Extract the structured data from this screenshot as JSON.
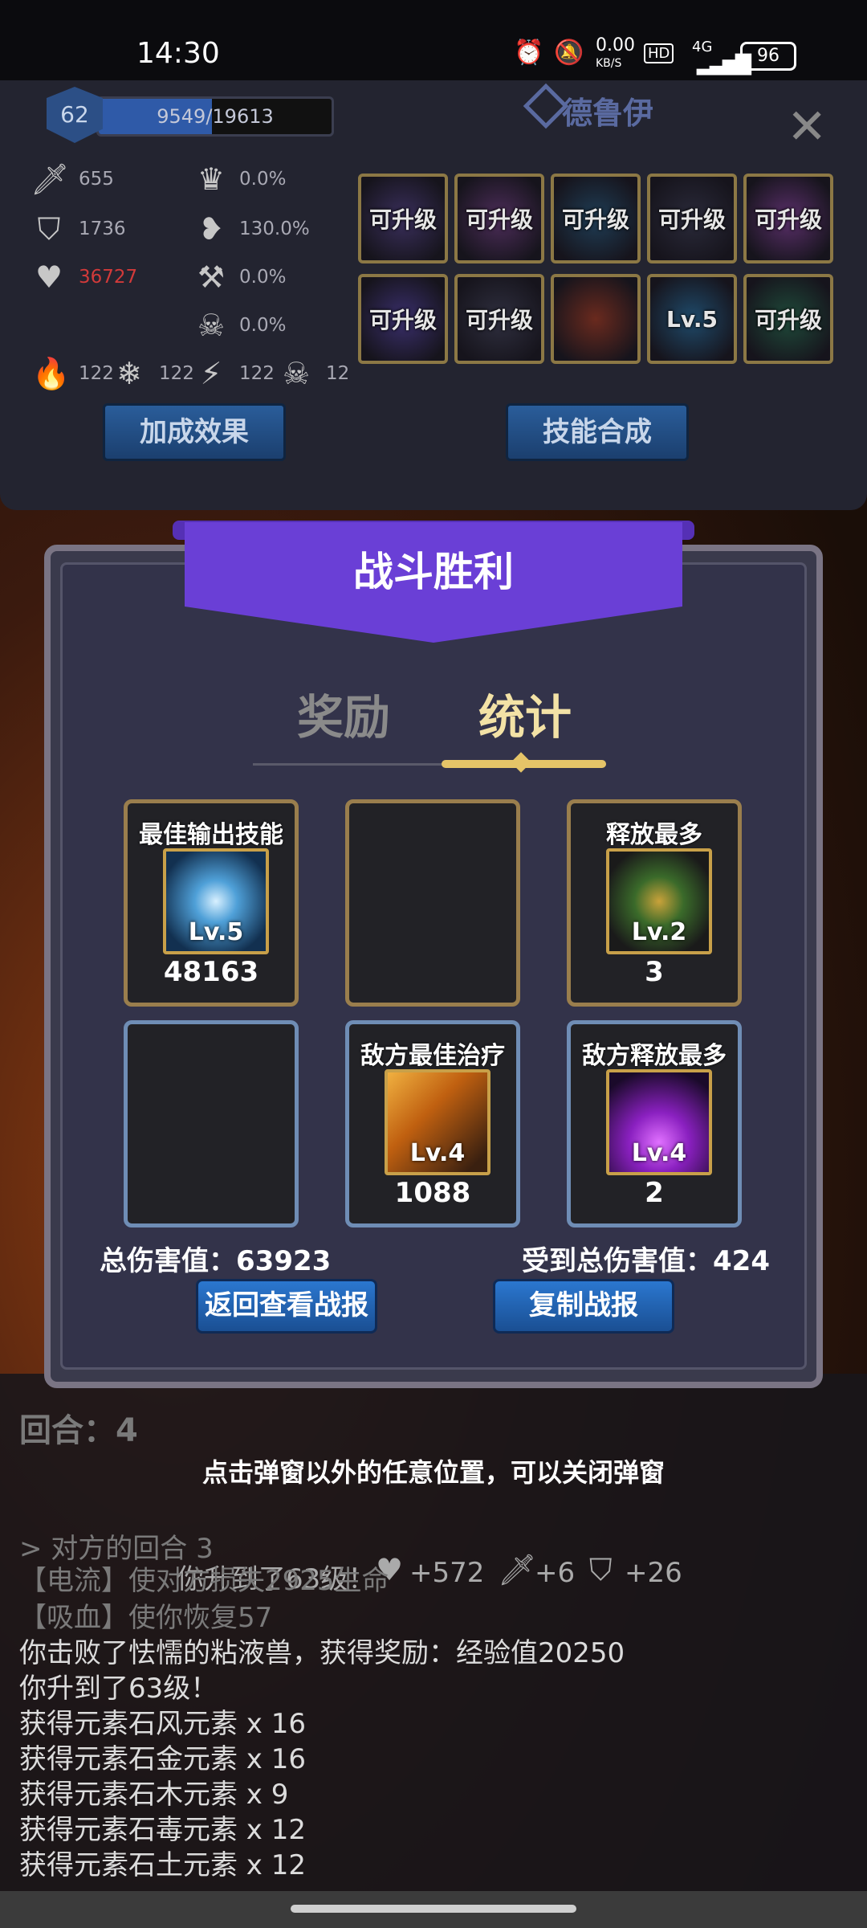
{
  "status": {
    "time": "14:30",
    "net_speed": "0.00",
    "net_unit": "KB/S",
    "hd": "HD",
    "signal": "4G",
    "battery": "96"
  },
  "character": {
    "level": "62",
    "xp": "9549/19613",
    "xp_fraction": 0.487,
    "name": "德鲁伊"
  },
  "stats": {
    "attack": "655",
    "defense": "1736",
    "hp": "36727",
    "crit": "0.0%",
    "crit_dmg": "130.0%",
    "pierce": "0.0%",
    "poison": "0.0%",
    "fire": "122",
    "ice": "122",
    "lightning": "122",
    "skull": "12"
  },
  "skills": [
    "可升级",
    "可升级",
    "可升级",
    "可升级",
    "可升级",
    "可升级",
    "可升级",
    "",
    "Lv.5",
    "可升级"
  ],
  "panel_buttons": {
    "bonus": "加成效果",
    "synth": "技能合成"
  },
  "modal": {
    "title": "战斗胜利",
    "tab_reward": "奖励",
    "tab_stats": "统计",
    "cards": [
      {
        "title": "最佳输出技能",
        "lv": "Lv.5",
        "value": "48163"
      },
      {
        "title": "",
        "lv": "",
        "value": ""
      },
      {
        "title": "释放最多",
        "lv": "Lv.2",
        "value": "3"
      },
      {
        "title": "",
        "lv": "",
        "value": ""
      },
      {
        "title": "敌方最佳治疗",
        "lv": "Lv.4",
        "value": "1088"
      },
      {
        "title": "敌方释放最多",
        "lv": "Lv.4",
        "value": "2"
      }
    ],
    "total_damage": "总伤害值：63923",
    "received_damage": "受到总伤害值：424",
    "btn_back": "返回查看战报",
    "btn_copy": "复制战报"
  },
  "hint": "点击弹窗以外的任意位置，可以关闭弹窗",
  "log": {
    "round_header": "回合：4",
    "opponent_round": "> 对方的回合 3",
    "level_up_banner": "你升到了63级！",
    "gain_hp": "+572",
    "gain_atk": "+6",
    "gain_def": "+26",
    "lines": [
      "【电流】使对方损失2925生命",
      "【吸血】使你恢复57",
      "你击败了怯懦的粘液兽，获得奖励：经验值20250",
      "你升到了63级！",
      "获得元素石风元素 x 16",
      "获得元素石金元素 x 16",
      "获得元素石木元素 x 9",
      "获得元素石毒元素 x 12",
      "获得元素石土元素 x 12"
    ]
  },
  "colors": {
    "banner": "#6a3fd6",
    "gold": "#e5c468",
    "hp_red": "#d23a3a",
    "accent_blue": "#2b77cf"
  }
}
